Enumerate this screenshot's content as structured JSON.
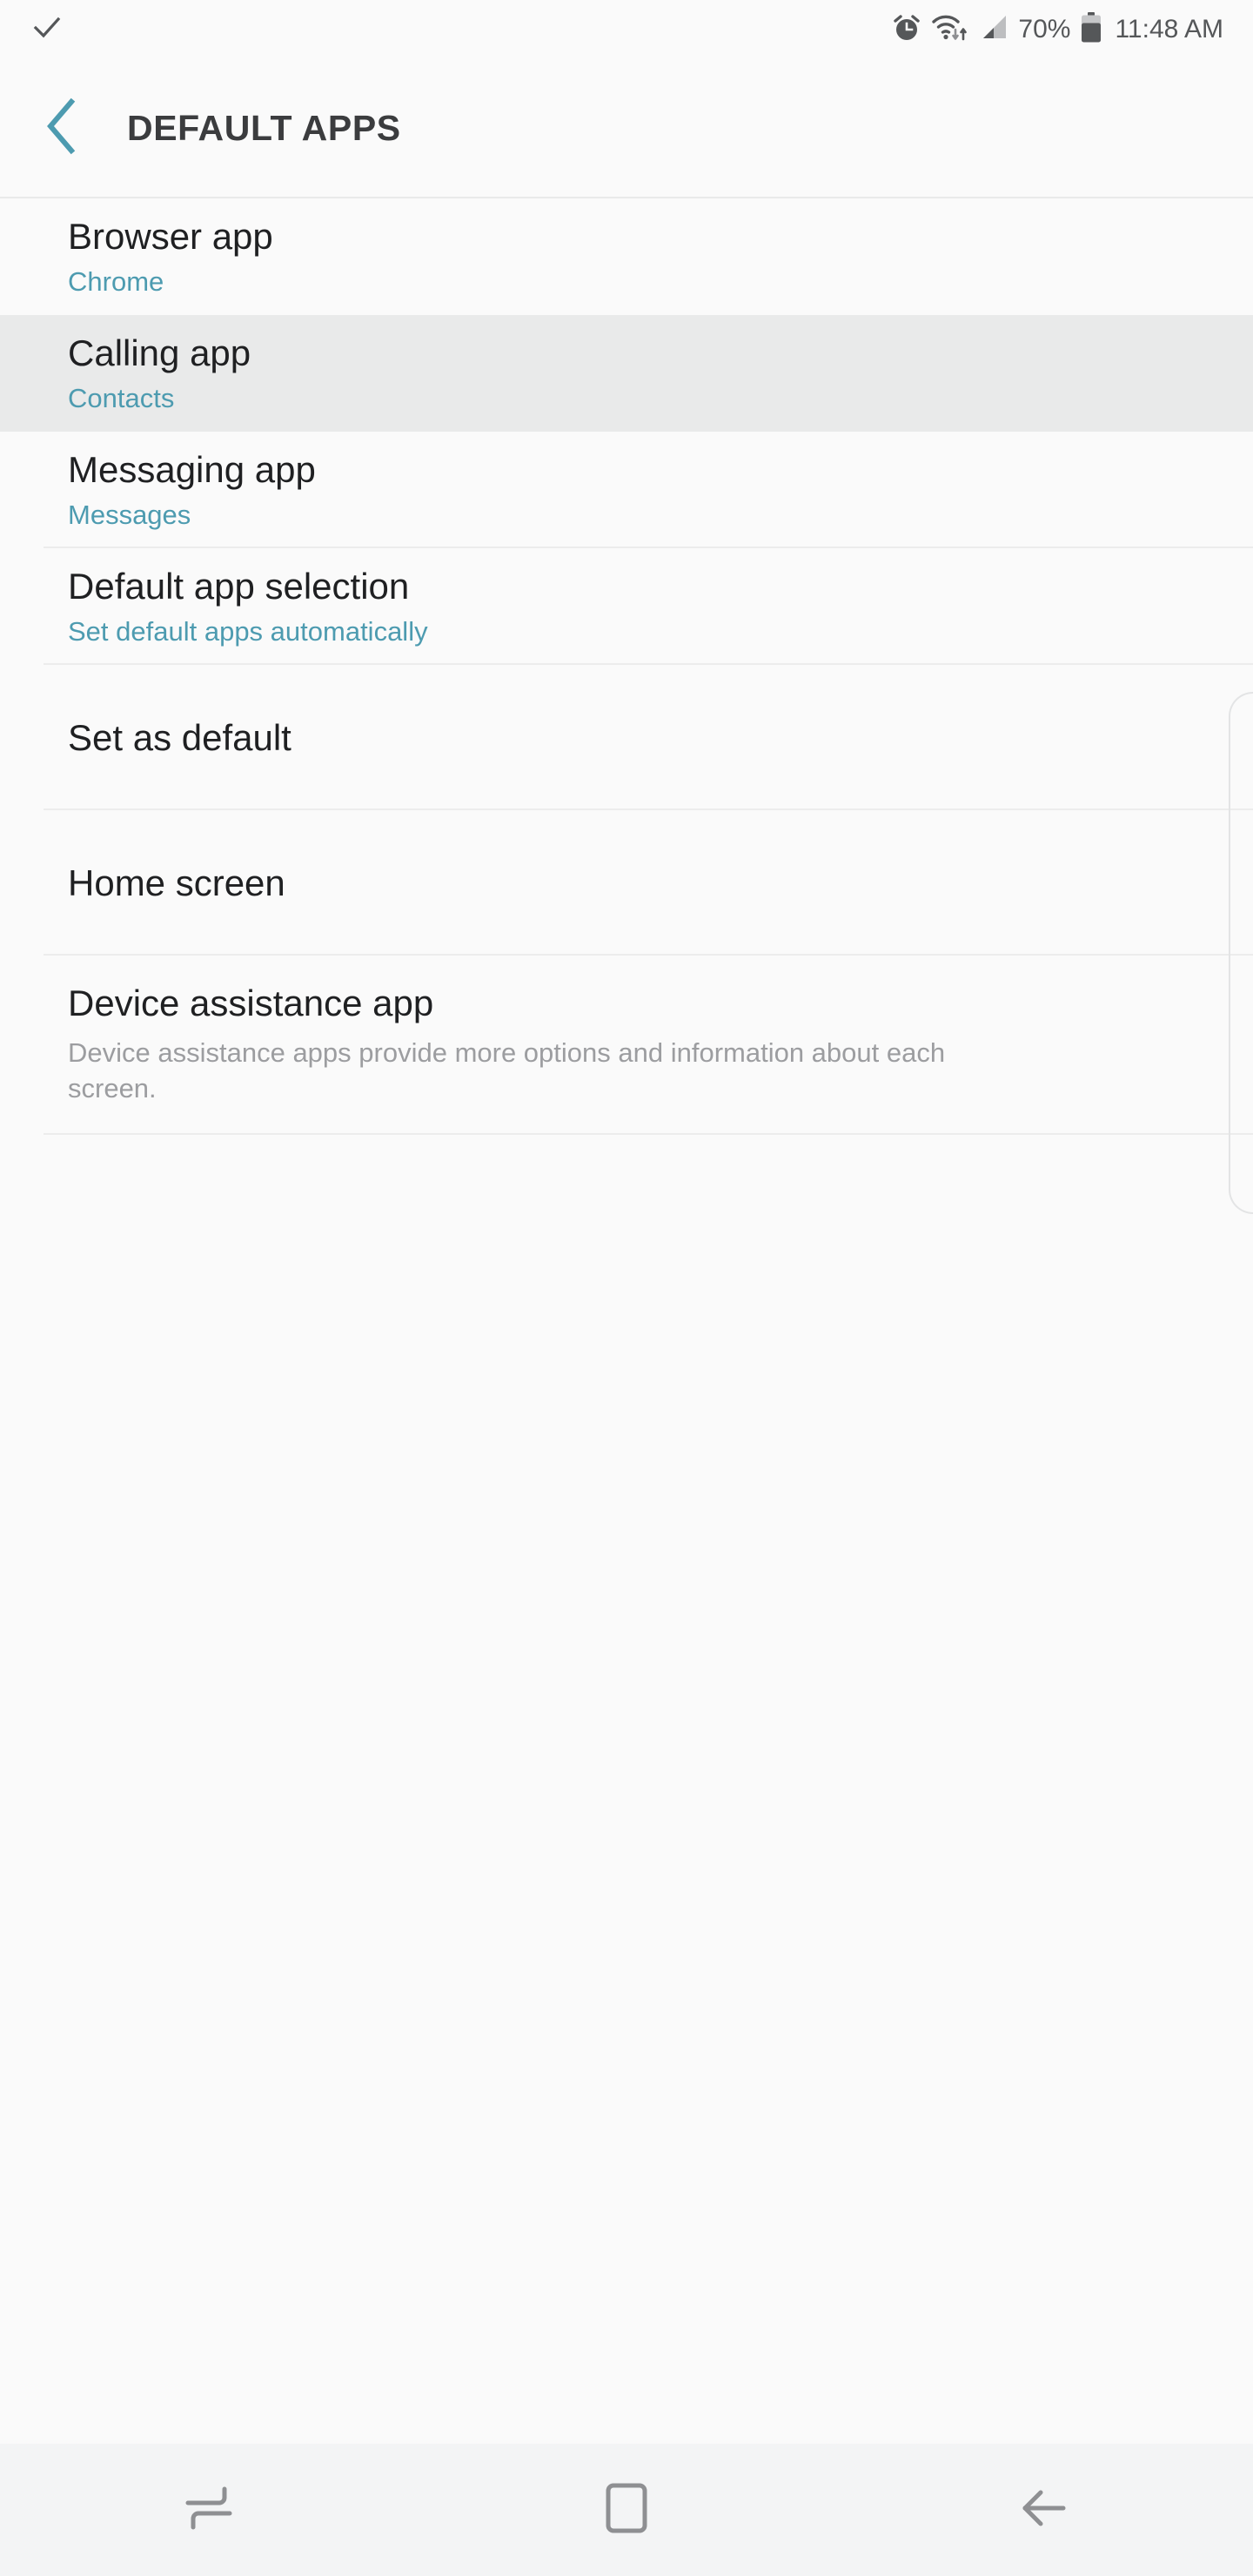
{
  "status_bar": {
    "left_icons": [
      {
        "name": "checkmark-icon",
        "label": "check"
      }
    ],
    "right_icons": [
      {
        "name": "alarm-clock-icon",
        "label": "alarm"
      },
      {
        "name": "wifi-icon",
        "label": "wifi-with-transfer-arrows"
      },
      {
        "name": "cellular-signal-icon",
        "label": "signal-2-of-4-bars"
      }
    ],
    "battery_percent": "70%",
    "battery_icon": "battery-icon",
    "battery_level": 70,
    "clock": "11:48 AM",
    "text_color": "#555759",
    "background": "#fafafa"
  },
  "header": {
    "back_icon": "chevron-left-icon",
    "back_icon_color": "#4d9bb0",
    "title": "DEFAULT APPS",
    "title_color": "#3b3c3e"
  },
  "theme": {
    "accent": "#4d9bb0",
    "background": "#fafafa",
    "highlight": "#e9eaea",
    "divider": "#ececec",
    "primary_text": "#1f2022",
    "muted_text": "#9c9da0",
    "nav_background": "#f3f4f5",
    "nav_icon": "#8e8f92"
  },
  "list": {
    "items": [
      {
        "id": "browser-app",
        "title": "Browser app",
        "subtitle": "Chrome",
        "subtitle_style": "accent",
        "highlighted": false,
        "divider": false,
        "type": "two-line"
      },
      {
        "id": "calling-app",
        "title": "Calling app",
        "subtitle": "Contacts",
        "subtitle_style": "accent",
        "highlighted": true,
        "divider": false,
        "type": "two-line"
      },
      {
        "id": "messaging-app",
        "title": "Messaging app",
        "subtitle": "Messages",
        "subtitle_style": "accent",
        "highlighted": false,
        "divider": true,
        "type": "two-line"
      },
      {
        "id": "default-app-selection",
        "title": "Default app selection",
        "subtitle": "Set default apps automatically",
        "subtitle_style": "accent",
        "highlighted": false,
        "divider": true,
        "type": "two-line"
      },
      {
        "id": "set-as-default",
        "title": "Set as default",
        "subtitle": "",
        "subtitle_style": "none",
        "highlighted": false,
        "divider": true,
        "type": "one-line"
      },
      {
        "id": "home-screen",
        "title": "Home screen",
        "subtitle": "",
        "subtitle_style": "none",
        "highlighted": false,
        "divider": true,
        "type": "one-line"
      },
      {
        "id": "device-assistance-app",
        "title": "Device assistance app",
        "subtitle": "Device assistance apps provide more options and information about each screen.",
        "subtitle_style": "muted",
        "highlighted": false,
        "divider": true,
        "type": "desc"
      }
    ]
  },
  "nav_bar": {
    "buttons": [
      {
        "id": "recents",
        "icon": "recents-icon",
        "label": "Recents"
      },
      {
        "id": "home",
        "icon": "home-icon",
        "label": "Home"
      },
      {
        "id": "back",
        "icon": "back-arrow-icon",
        "label": "Back"
      }
    ]
  }
}
